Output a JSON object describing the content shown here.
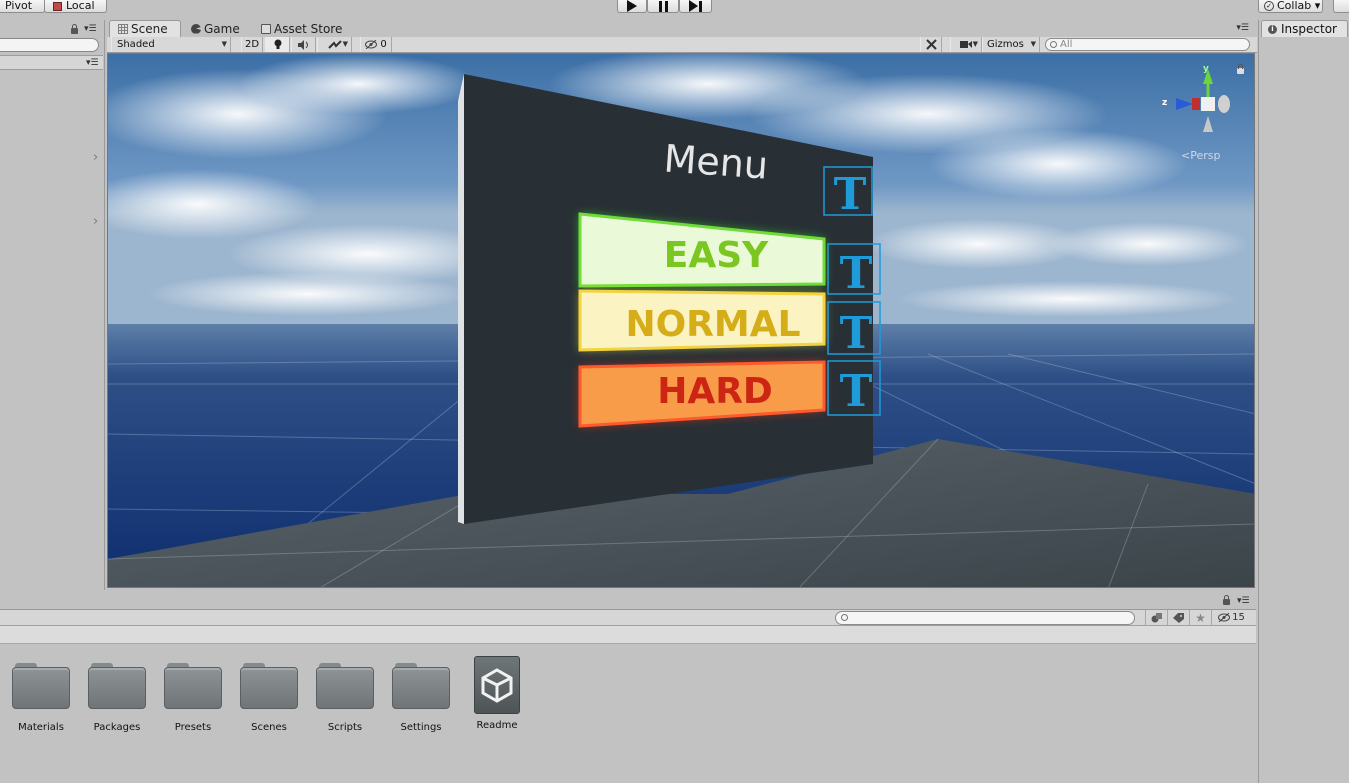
{
  "toolbar": {
    "pivot_label": "Pivot",
    "local_label": "Local",
    "collab_label": "Collab ▾"
  },
  "scene_view": {
    "tabs": [
      {
        "label": "Scene",
        "icon": "grid-icon"
      },
      {
        "label": "Game",
        "icon": "game-icon"
      },
      {
        "label": "Asset Store",
        "icon": "store-icon"
      }
    ],
    "shading_mode": "Shaded",
    "mode_2d": "2D",
    "hidden_count": "0",
    "gizmos_label": "Gizmos",
    "search_placeholder": "All",
    "projection_label": "Persp",
    "axis_y": "y",
    "axis_z": "z",
    "menu_title": "Menu",
    "buttons": [
      {
        "label": "EASY",
        "color": "#78c81e",
        "bg": "#e8f8d6"
      },
      {
        "label": "NORMAL",
        "color": "#d4b01c",
        "bg": "#fbf4c8"
      },
      {
        "label": "HARD",
        "color": "#c8281a",
        "bg": "#f89a4c"
      }
    ],
    "text_gizmo_glyph": "T"
  },
  "inspector": {
    "tab_label": "Inspector"
  },
  "project": {
    "hidden_count": "15",
    "assets": [
      {
        "name": "Materials",
        "type": "folder"
      },
      {
        "name": "Packages",
        "type": "folder"
      },
      {
        "name": "Presets",
        "type": "folder"
      },
      {
        "name": "Scenes",
        "type": "folder"
      },
      {
        "name": "Scripts",
        "type": "folder"
      },
      {
        "name": "Settings",
        "type": "folder"
      },
      {
        "name": "Readme",
        "type": "unity-asset"
      }
    ]
  }
}
